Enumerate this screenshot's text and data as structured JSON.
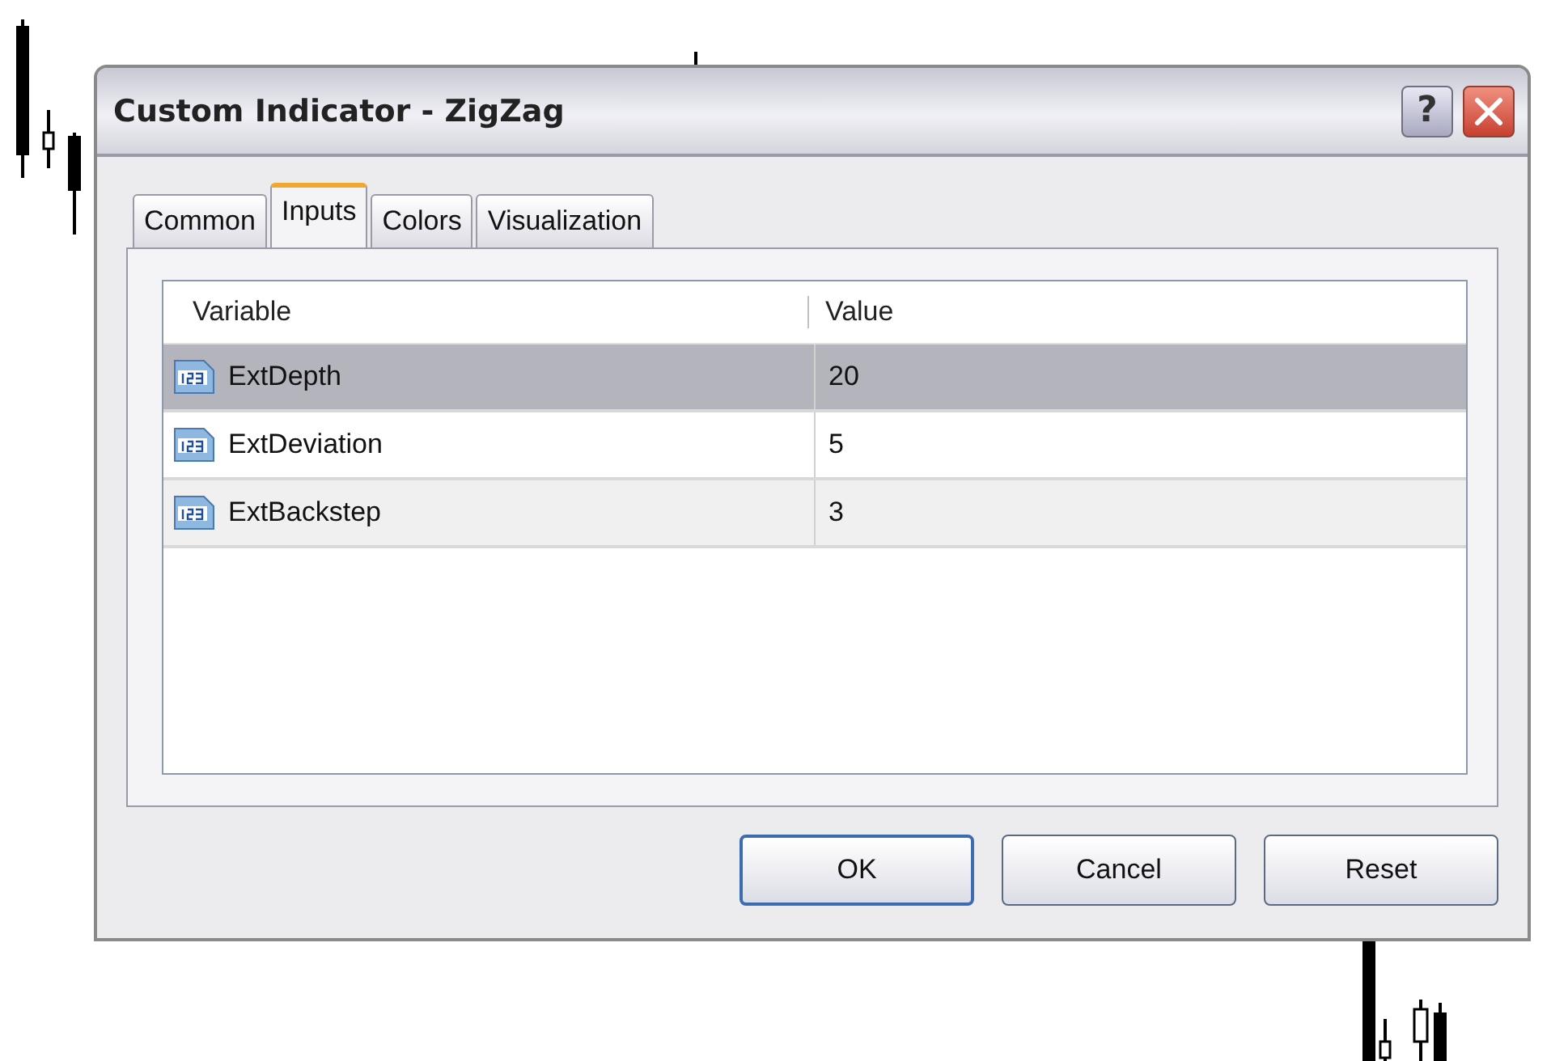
{
  "window": {
    "title": "Custom Indicator - ZigZag",
    "help_label": "?"
  },
  "tabs": [
    {
      "label": "Common",
      "selected": false
    },
    {
      "label": "Inputs",
      "selected": true
    },
    {
      "label": "Colors",
      "selected": false
    },
    {
      "label": "Visualization",
      "selected": false
    }
  ],
  "table": {
    "columns": [
      "Variable",
      "Value"
    ],
    "rows": [
      {
        "name": "ExtDepth",
        "value": "20",
        "selected": true
      },
      {
        "name": "ExtDeviation",
        "value": "5",
        "selected": false
      },
      {
        "name": "ExtBackstep",
        "value": "3",
        "selected": false
      }
    ]
  },
  "buttons": [
    {
      "label": "OK",
      "default": true
    },
    {
      "label": "Cancel",
      "default": false
    },
    {
      "label": "Reset",
      "default": false
    }
  ]
}
